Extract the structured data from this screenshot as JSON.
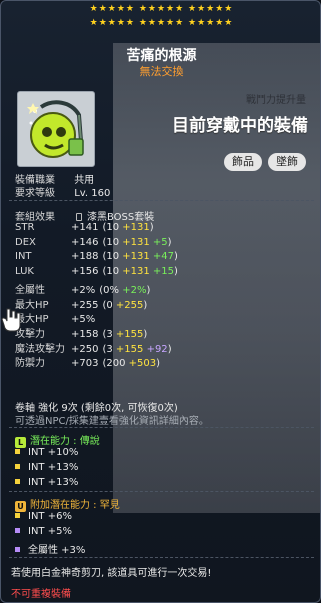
{
  "stars": {
    "row1": "★★★★★ ★★★★★ ★★★★★",
    "row2": "★★★★★ ★★★★★ ★★★★★"
  },
  "item": {
    "name": "苦痛的根源",
    "trade_status": "無法交換"
  },
  "power": {
    "label": "戰鬥力提升量",
    "value": "目前穿戴中的裝備"
  },
  "tags": [
    "飾品",
    "墜飾"
  ],
  "requirements": [
    {
      "label": "裝備職業",
      "value": "共用"
    },
    {
      "label": "要求等級",
      "value": "Lv. 160"
    }
  ],
  "set": {
    "label": "套組效果",
    "value": "漆黑BOSS套裝"
  },
  "stats": [
    {
      "name": "STR",
      "total": "+141",
      "base": "(10 ",
      "star": "+131",
      "extra": "",
      "close": ")"
    },
    {
      "name": "DEX",
      "total": "+146",
      "base": "(10 ",
      "star": "+131",
      "extra": " +5",
      "close": ")"
    },
    {
      "name": "INT",
      "total": "+188",
      "base": "(10 ",
      "star": "+131",
      "extra": " +47",
      "close": ")"
    },
    {
      "name": "LUK",
      "total": "+156",
      "base": "(10 ",
      "star": "+131",
      "extra": " +15",
      "close": ")"
    },
    {
      "name": "全屬性",
      "total": "+2%",
      "base": "(0% ",
      "star": "",
      "extra": "+2%",
      "close": ")"
    },
    {
      "name": "最大HP",
      "total": "+255",
      "base": "(0 ",
      "star": "+255",
      "extra": "",
      "close": ")"
    },
    {
      "name": "最大HP",
      "total": "+5%",
      "base": "",
      "star": "",
      "extra": "",
      "close": ""
    },
    {
      "name": "攻擊力",
      "total": "+158",
      "base": "(3 ",
      "star": "+155",
      "extra": "",
      "close": ")"
    },
    {
      "name": "魔法攻擊力",
      "total": "+250",
      "base": "(3 ",
      "star": "+155",
      "extra2": " +92",
      "close": ")"
    },
    {
      "name": "防禦力",
      "total": "+703",
      "base": "(200 ",
      "star": "+503",
      "extra": "",
      "close": ")"
    }
  ],
  "scroll": {
    "text": "卷軸 強化 9次 (剩餘0次, 可恢復0次)"
  },
  "note": "可透過NPC/採集建壹看強化資訊詳細內容。",
  "potential": {
    "title": "潛在能力 : 傳說",
    "lines": [
      "INT +10%",
      "INT +13%",
      "INT +13%"
    ]
  },
  "additional": {
    "title": "附加潛在能力 : 罕見",
    "lines": [
      "INT +6%",
      "INT +5%",
      "全屬性 +3%"
    ]
  },
  "scissors_note": "若使用白金神奇剪刀, 該道具可進行一次交易!",
  "warning": "不可重複裝備",
  "colors": {
    "star": "#ffd21f",
    "star_bonus": "#ffe33f",
    "extra": "#79f05a",
    "untradable": "#ff9f2f",
    "warning": "#ff4d4d"
  },
  "icons": [
    "star-icon",
    "pendant-item-icon",
    "lock-pad-icon",
    "legendary-badge-icon",
    "unique-badge-icon",
    "hand-cursor-icon"
  ]
}
